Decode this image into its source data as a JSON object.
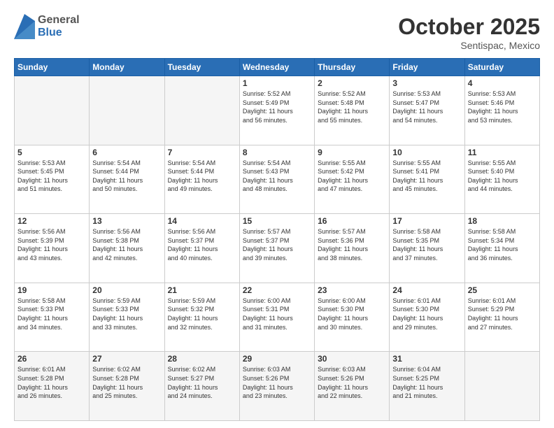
{
  "header": {
    "logo": {
      "general": "General",
      "blue": "Blue"
    },
    "title": "October 2025",
    "location": "Sentispac, Mexico"
  },
  "days_of_week": [
    "Sunday",
    "Monday",
    "Tuesday",
    "Wednesday",
    "Thursday",
    "Friday",
    "Saturday"
  ],
  "weeks": [
    [
      {
        "day": "",
        "info": ""
      },
      {
        "day": "",
        "info": ""
      },
      {
        "day": "",
        "info": ""
      },
      {
        "day": "1",
        "info": "Sunrise: 5:52 AM\nSunset: 5:49 PM\nDaylight: 11 hours\nand 56 minutes."
      },
      {
        "day": "2",
        "info": "Sunrise: 5:52 AM\nSunset: 5:48 PM\nDaylight: 11 hours\nand 55 minutes."
      },
      {
        "day": "3",
        "info": "Sunrise: 5:53 AM\nSunset: 5:47 PM\nDaylight: 11 hours\nand 54 minutes."
      },
      {
        "day": "4",
        "info": "Sunrise: 5:53 AM\nSunset: 5:46 PM\nDaylight: 11 hours\nand 53 minutes."
      }
    ],
    [
      {
        "day": "5",
        "info": "Sunrise: 5:53 AM\nSunset: 5:45 PM\nDaylight: 11 hours\nand 51 minutes."
      },
      {
        "day": "6",
        "info": "Sunrise: 5:54 AM\nSunset: 5:44 PM\nDaylight: 11 hours\nand 50 minutes."
      },
      {
        "day": "7",
        "info": "Sunrise: 5:54 AM\nSunset: 5:44 PM\nDaylight: 11 hours\nand 49 minutes."
      },
      {
        "day": "8",
        "info": "Sunrise: 5:54 AM\nSunset: 5:43 PM\nDaylight: 11 hours\nand 48 minutes."
      },
      {
        "day": "9",
        "info": "Sunrise: 5:55 AM\nSunset: 5:42 PM\nDaylight: 11 hours\nand 47 minutes."
      },
      {
        "day": "10",
        "info": "Sunrise: 5:55 AM\nSunset: 5:41 PM\nDaylight: 11 hours\nand 45 minutes."
      },
      {
        "day": "11",
        "info": "Sunrise: 5:55 AM\nSunset: 5:40 PM\nDaylight: 11 hours\nand 44 minutes."
      }
    ],
    [
      {
        "day": "12",
        "info": "Sunrise: 5:56 AM\nSunset: 5:39 PM\nDaylight: 11 hours\nand 43 minutes."
      },
      {
        "day": "13",
        "info": "Sunrise: 5:56 AM\nSunset: 5:38 PM\nDaylight: 11 hours\nand 42 minutes."
      },
      {
        "day": "14",
        "info": "Sunrise: 5:56 AM\nSunset: 5:37 PM\nDaylight: 11 hours\nand 40 minutes."
      },
      {
        "day": "15",
        "info": "Sunrise: 5:57 AM\nSunset: 5:37 PM\nDaylight: 11 hours\nand 39 minutes."
      },
      {
        "day": "16",
        "info": "Sunrise: 5:57 AM\nSunset: 5:36 PM\nDaylight: 11 hours\nand 38 minutes."
      },
      {
        "day": "17",
        "info": "Sunrise: 5:58 AM\nSunset: 5:35 PM\nDaylight: 11 hours\nand 37 minutes."
      },
      {
        "day": "18",
        "info": "Sunrise: 5:58 AM\nSunset: 5:34 PM\nDaylight: 11 hours\nand 36 minutes."
      }
    ],
    [
      {
        "day": "19",
        "info": "Sunrise: 5:58 AM\nSunset: 5:33 PM\nDaylight: 11 hours\nand 34 minutes."
      },
      {
        "day": "20",
        "info": "Sunrise: 5:59 AM\nSunset: 5:33 PM\nDaylight: 11 hours\nand 33 minutes."
      },
      {
        "day": "21",
        "info": "Sunrise: 5:59 AM\nSunset: 5:32 PM\nDaylight: 11 hours\nand 32 minutes."
      },
      {
        "day": "22",
        "info": "Sunrise: 6:00 AM\nSunset: 5:31 PM\nDaylight: 11 hours\nand 31 minutes."
      },
      {
        "day": "23",
        "info": "Sunrise: 6:00 AM\nSunset: 5:30 PM\nDaylight: 11 hours\nand 30 minutes."
      },
      {
        "day": "24",
        "info": "Sunrise: 6:01 AM\nSunset: 5:30 PM\nDaylight: 11 hours\nand 29 minutes."
      },
      {
        "day": "25",
        "info": "Sunrise: 6:01 AM\nSunset: 5:29 PM\nDaylight: 11 hours\nand 27 minutes."
      }
    ],
    [
      {
        "day": "26",
        "info": "Sunrise: 6:01 AM\nSunset: 5:28 PM\nDaylight: 11 hours\nand 26 minutes."
      },
      {
        "day": "27",
        "info": "Sunrise: 6:02 AM\nSunset: 5:28 PM\nDaylight: 11 hours\nand 25 minutes."
      },
      {
        "day": "28",
        "info": "Sunrise: 6:02 AM\nSunset: 5:27 PM\nDaylight: 11 hours\nand 24 minutes."
      },
      {
        "day": "29",
        "info": "Sunrise: 6:03 AM\nSunset: 5:26 PM\nDaylight: 11 hours\nand 23 minutes."
      },
      {
        "day": "30",
        "info": "Sunrise: 6:03 AM\nSunset: 5:26 PM\nDaylight: 11 hours\nand 22 minutes."
      },
      {
        "day": "31",
        "info": "Sunrise: 6:04 AM\nSunset: 5:25 PM\nDaylight: 11 hours\nand 21 minutes."
      },
      {
        "day": "",
        "info": ""
      }
    ]
  ]
}
